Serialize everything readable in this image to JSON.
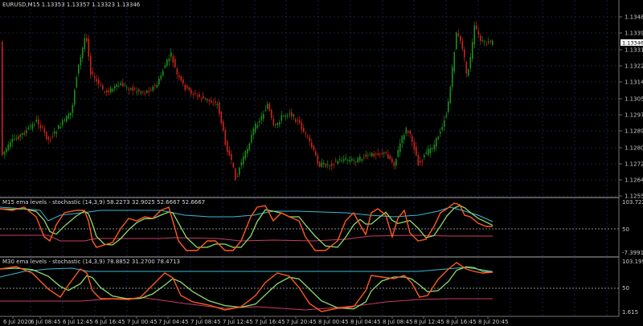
{
  "main": {
    "symbol_header": "EURUSD,M15  1.13353 1.13357 1.13323 1.13346",
    "price_ticks": [
      "1.13480",
      "1.13395",
      "1.13310",
      "1.13225",
      "1.13140",
      "1.13055",
      "1.12970",
      "1.12890",
      "1.12805",
      "1.12725",
      "1.12640",
      "1.12555"
    ],
    "current_price": "1.13346",
    "colors": {
      "bull": "#1d8f1d",
      "bear": "#c8261c",
      "grid": "#1f2f5a",
      "price_box": "#ffffff"
    }
  },
  "panel1": {
    "title": "M15 ema levels - stochastic (14,3,9) 58.2273 32.9025 52.6667 52.6667",
    "ticks": [
      "103.7225",
      "50",
      "-7.3991"
    ],
    "colors": {
      "k": "#ff5a1f",
      "d": "#8fdc6a",
      "ema_cyan": "#3cb7d8",
      "ema_red": "#c83c64"
    }
  },
  "panel2": {
    "title": "M30 ema levels - stochastic (14,3,9) 78.8852 31.2700 78.4713",
    "ticks": [
      "103.199",
      "50",
      "1.615"
    ]
  },
  "time_axis": [
    "6 Jul 2020",
    "6 Jul 08:45",
    "6 Jul 12:45",
    "6 Jul 16:45",
    "7 Jul 00:45",
    "7 Jul 04:45",
    "7 Jul 08:45",
    "7 Jul 12:45",
    "7 Jul 16:45",
    "7 Jul 20:45",
    "8 Jul 00:45",
    "8 Jul 04:45",
    "8 Jul 08:45",
    "8 Jul 12:45",
    "8 Jul 16:45",
    "8 Jul 20:45"
  ]
}
